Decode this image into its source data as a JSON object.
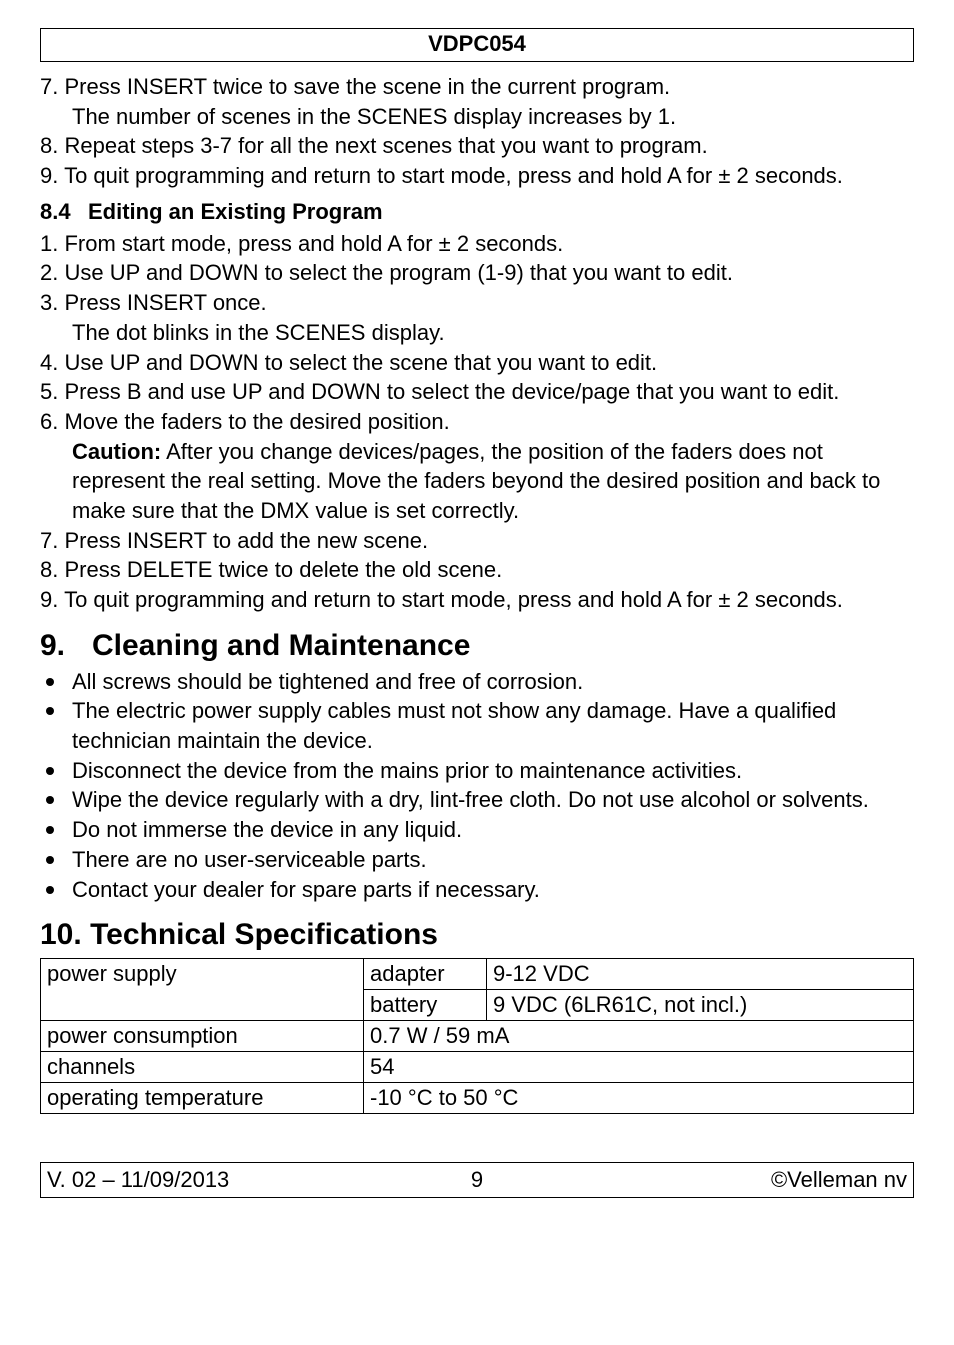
{
  "header": {
    "code": "VDPC054"
  },
  "list1": [
    {
      "num": "7.",
      "text": "Press INSERT twice to save the scene in the current program.",
      "sub": "The number of scenes in the SCENES display increases by 1."
    },
    {
      "num": "8.",
      "text": "Repeat steps 3-7 for all the next scenes that you want to program."
    },
    {
      "num": "9.",
      "text": "To quit programming and return to start mode, press and hold A for ± 2 seconds."
    }
  ],
  "section84": {
    "num": "8.4",
    "title": "Editing an Existing Program"
  },
  "list2": [
    {
      "num": "1.",
      "text": "From start mode, press and hold A for ± 2 seconds."
    },
    {
      "num": "2.",
      "text": "Use UP and DOWN to select the program (1-9) that you want to edit."
    },
    {
      "num": "3.",
      "text": "Press INSERT once.",
      "sub": "The dot blinks in the SCENES display."
    },
    {
      "num": "4.",
      "text": "Use UP and DOWN to select the scene that you want to edit."
    },
    {
      "num": "5.",
      "text": "Press B and use UP and DOWN to select the device/page that you want to edit."
    },
    {
      "num": "6.",
      "text": "Move the faders to the desired position.",
      "caution_label": "Caution:",
      "caution_text": " After you change devices/pages, the position of the faders does not represent the real setting. Move the faders beyond the desired position and back to make sure that the DMX value is set correctly."
    },
    {
      "num": "7.",
      "text": "Press INSERT to add the new scene."
    },
    {
      "num": "8.",
      "text": "Press DELETE twice to delete the old scene."
    },
    {
      "num": "9.",
      "text": "To quit programming and return to start mode, press and hold A for ± 2 seconds."
    }
  ],
  "section9": {
    "num": "9.",
    "title": "Cleaning and Maintenance"
  },
  "bullets9": [
    "All screws should be tightened and free of corrosion.",
    "The electric power supply cables must not show any damage. Have a qualified technician maintain the device.",
    "Disconnect the device from the mains prior to maintenance activities.",
    "Wipe the device regularly with a dry, lint-free cloth. Do not use alcohol or solvents.",
    "Do not immerse the device in any liquid.",
    "There are no user-serviceable parts.",
    "Contact your dealer for spare parts if necessary."
  ],
  "section10": {
    "num": "10.",
    "title": "Technical Specifications"
  },
  "spec": {
    "row1": {
      "label": "power supply",
      "k1": "adapter",
      "v1": "9-12 VDC",
      "k2": "battery",
      "v2": "9 VDC (6LR61C, not incl.)"
    },
    "row2": {
      "label": "power consumption",
      "value": "0.7 W / 59 mA"
    },
    "row3": {
      "label": "channels",
      "value": "54"
    },
    "row4": {
      "label": "operating temperature",
      "value": "-10 °C to 50 °C"
    }
  },
  "footer": {
    "left": "V. 02 – 11/09/2013",
    "mid": "9",
    "right": "©Velleman nv"
  }
}
